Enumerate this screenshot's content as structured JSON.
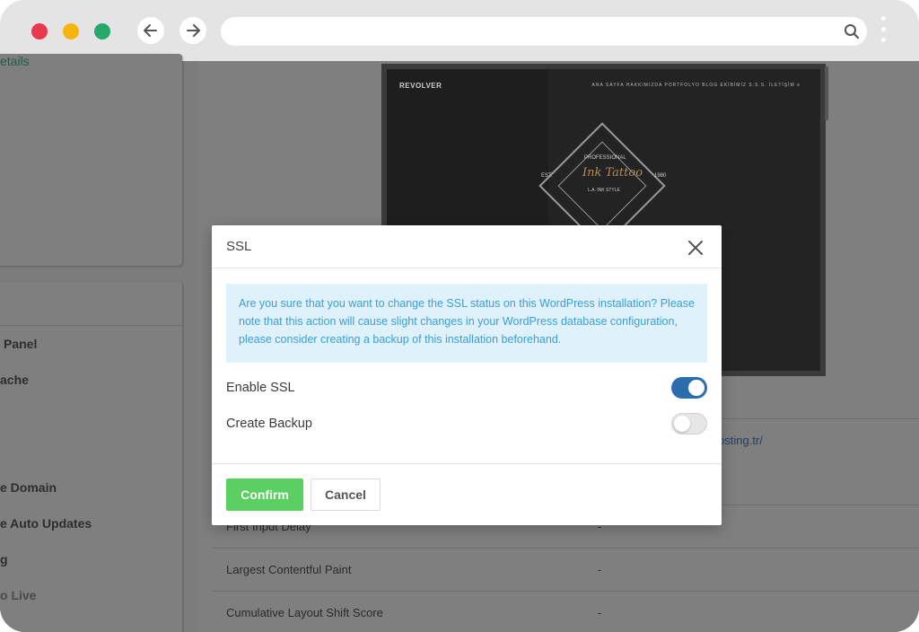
{
  "browser": {
    "url": "",
    "icons": {
      "back": "arrow-left-icon",
      "forward": "arrow-right-icon",
      "search": "search-icon",
      "menu": "kebab-menu-icon"
    }
  },
  "background": {
    "left_link": "etails",
    "left_items": [
      "Panel",
      "ache",
      "e Domain",
      "e Auto Updates",
      "g",
      "o Live"
    ],
    "preview": {
      "brand": "REVOLVER",
      "menu": "ANA SAYFA   HAKKIMIZDA   PORTFOLYO   BLOG   EKİBİMİZ   S.S.S.   İLETİŞİM   ≡",
      "badge_top": "PROFESSIONAL",
      "badge_script": "Ink Tattoo",
      "badge_sub": "L.A. INK STYLE",
      "est": "EST.",
      "year": "1980"
    },
    "partial_link": "osting.tr/",
    "rows": [
      {
        "label": "First Input Delay",
        "value": "-"
      },
      {
        "label": "Largest Contentful Paint",
        "value": "-"
      },
      {
        "label": "Cumulative Layout Shift Score",
        "value": "-"
      }
    ]
  },
  "modal": {
    "title": "SSL",
    "alert": "Are you sure that you want to change the SSL status on this WordPress installation? Please note that this action will cause slight changes in your WordPress database configuration, please consider creating a backup of this installation beforehand.",
    "toggles": [
      {
        "label": "Enable SSL",
        "on": true
      },
      {
        "label": "Create Backup",
        "on": false
      }
    ],
    "confirm_label": "Confirm",
    "cancel_label": "Cancel",
    "colors": {
      "confirm": "#5ccf63",
      "toggle_on": "#2b6eae",
      "alert_bg": "#dff1fb",
      "alert_text": "#3a9fd6"
    }
  }
}
